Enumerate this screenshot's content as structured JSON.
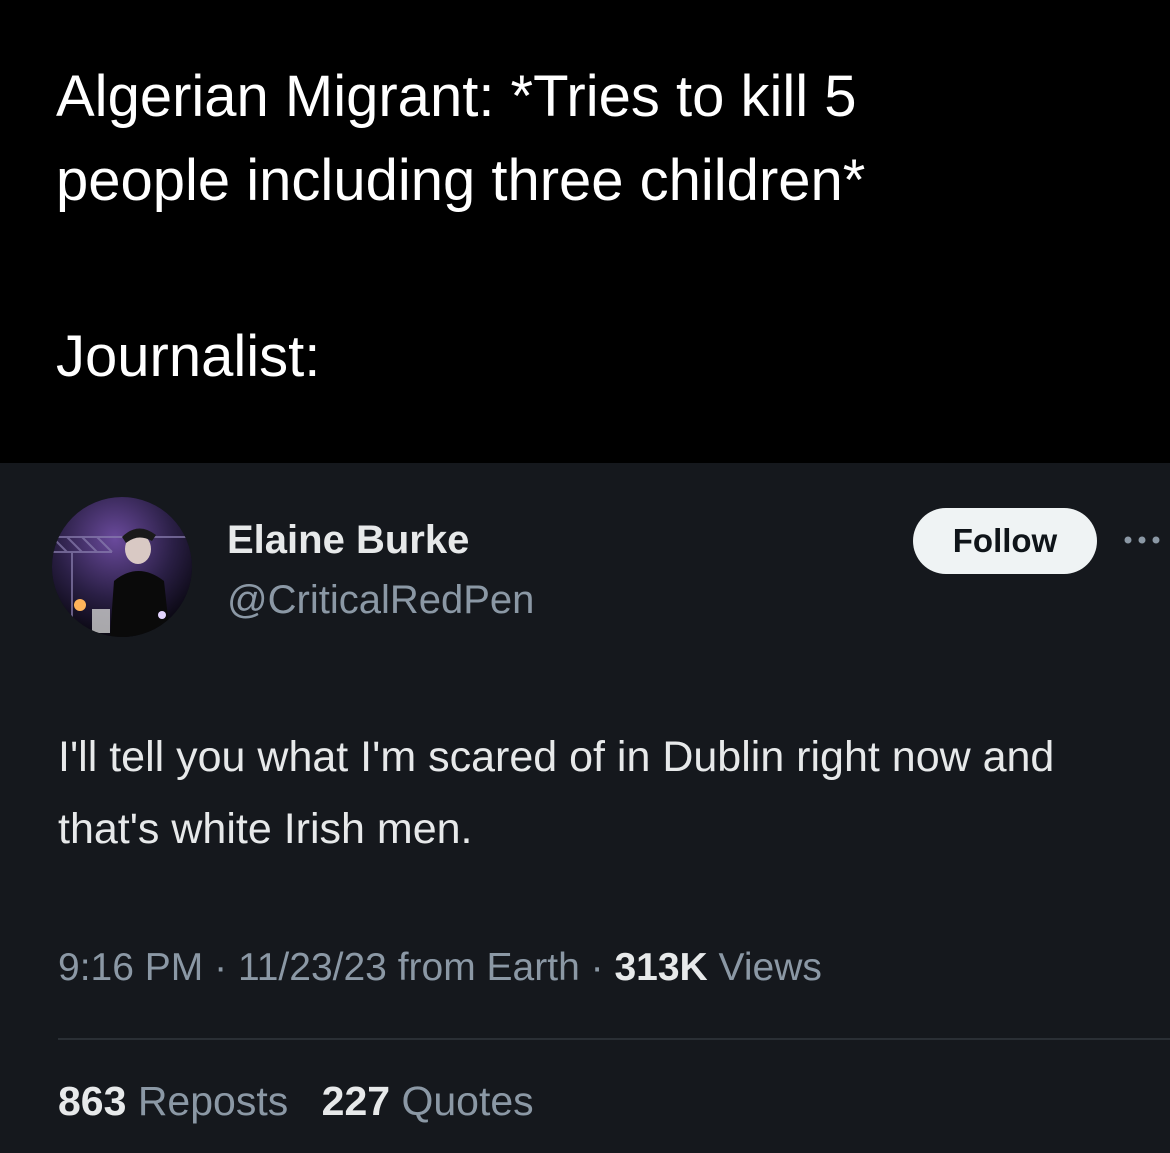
{
  "caption": {
    "line1": "Algerian Migrant: *Tries to kill 5",
    "line2": "people including three children*",
    "line3": "Journalist:"
  },
  "tweet": {
    "display_name": "Elaine Burke",
    "handle": "@CriticalRedPen",
    "follow_label": "Follow",
    "text": "I'll tell you what I'm scared of in Dublin right now and that's white Irish men.",
    "time": "9:16 PM",
    "date": "11/23/23",
    "source": "from Earth",
    "separator": "·",
    "views_count": "313K",
    "views_label": "Views",
    "reposts_count": "863",
    "reposts_label": "Reposts",
    "quotes_count": "227",
    "quotes_label": "Quotes"
  },
  "icons": {
    "avatar": "avatar-photo",
    "more": "more-icon"
  },
  "colors": {
    "caption_bg": "#000000",
    "tweet_bg": "#15181d",
    "primary_text": "#e7e9ea",
    "secondary_text": "#8b98a5",
    "follow_bg": "#eff3f4"
  }
}
